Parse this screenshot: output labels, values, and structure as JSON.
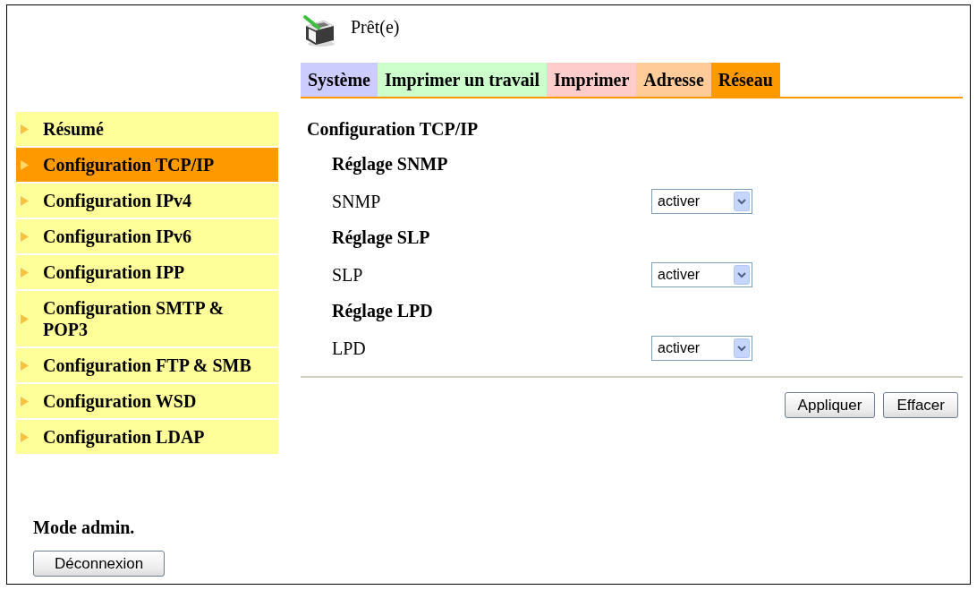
{
  "status": {
    "text": "Prêt(e)"
  },
  "tabs": [
    {
      "label": "Système",
      "color": "#ccccff",
      "selected": false
    },
    {
      "label": "Imprimer un travail",
      "color": "#ccffcc",
      "selected": false
    },
    {
      "label": "Imprimer",
      "color": "#ffcccc",
      "selected": false
    },
    {
      "label": "Adresse",
      "color": "#ffcc99",
      "selected": false
    },
    {
      "label": "Réseau",
      "color": "#ff9900",
      "selected": true
    }
  ],
  "sidebar": {
    "items": [
      {
        "label": "Résumé",
        "selected": false
      },
      {
        "label": "Configuration TCP/IP",
        "selected": true
      },
      {
        "label": "Configuration IPv4",
        "selected": false
      },
      {
        "label": "Configuration IPv6",
        "selected": false
      },
      {
        "label": "Configuration IPP",
        "selected": false
      },
      {
        "label": "Configuration SMTP & POP3",
        "selected": false
      },
      {
        "label": "Configuration FTP & SMB",
        "selected": false
      },
      {
        "label": "Configuration WSD",
        "selected": false
      },
      {
        "label": "Configuration LDAP",
        "selected": false
      }
    ]
  },
  "content": {
    "heading": "Configuration TCP/IP",
    "sections": [
      {
        "heading": "Réglage SNMP",
        "label": "SNMP",
        "value": "activer"
      },
      {
        "heading": "Réglage SLP",
        "label": "SLP",
        "value": "activer"
      },
      {
        "heading": "Réglage LPD",
        "label": "LPD",
        "value": "activer"
      }
    ],
    "buttons": [
      "Appliquer",
      "Effacer"
    ]
  },
  "admin": {
    "mode": "Mode admin.",
    "logout": "Déconnexion"
  }
}
